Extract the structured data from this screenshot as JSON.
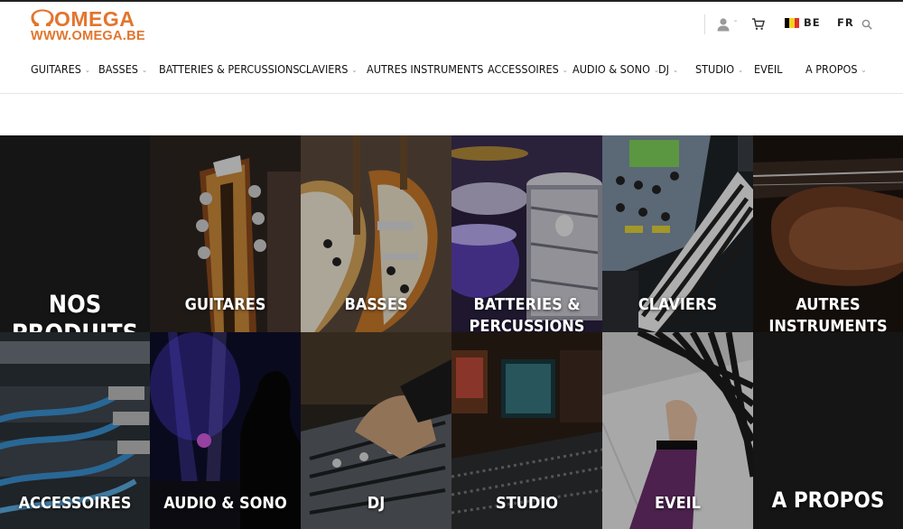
{
  "brand": {
    "name": "OMEGA",
    "url": "WWW.OMEGA.BE",
    "color": "#e2752d"
  },
  "header_tools": {
    "user_icon": "user-icon",
    "cart_icon": "cart-icon",
    "country": "BE",
    "language": "FR",
    "search_icon": "search-icon",
    "flag_colors": [
      "#000000",
      "#f6d21e",
      "#e0312a"
    ]
  },
  "nav": {
    "items": [
      {
        "label": "GUITARES",
        "has_dropdown": true
      },
      {
        "label": "BASSES",
        "has_dropdown": true
      },
      {
        "label": "BATTERIES & PERCUSSIONS",
        "has_dropdown": true
      },
      {
        "label": "CLAVIERS",
        "has_dropdown": true
      },
      {
        "label": "AUTRES INSTRUMENTS",
        "has_dropdown": true
      },
      {
        "label": "ACCESSOIRES",
        "has_dropdown": true
      },
      {
        "label": "AUDIO & SONO",
        "has_dropdown": true
      },
      {
        "label": "DJ",
        "has_dropdown": true
      },
      {
        "label": "STUDIO",
        "has_dropdown": true
      },
      {
        "label": "EVEIL",
        "has_dropdown": false
      },
      {
        "label": "A PROPOS",
        "has_dropdown": true
      }
    ]
  },
  "tiles": {
    "row1": [
      {
        "label": "NOS PRODUITS"
      },
      {
        "label": "GUITARES"
      },
      {
        "label": "BASSES"
      },
      {
        "label": "BATTERIES &",
        "label2": "PERCUSSIONS"
      },
      {
        "label": "CLAVIERS"
      },
      {
        "label": "AUTRES INSTRUMENTS"
      }
    ],
    "row2": [
      {
        "label": "ACCESSOIRES"
      },
      {
        "label": "AUDIO & SONO"
      },
      {
        "label": "DJ"
      },
      {
        "label": "STUDIO"
      },
      {
        "label": "EVEIL"
      },
      {
        "label": "A PROPOS"
      }
    ]
  }
}
